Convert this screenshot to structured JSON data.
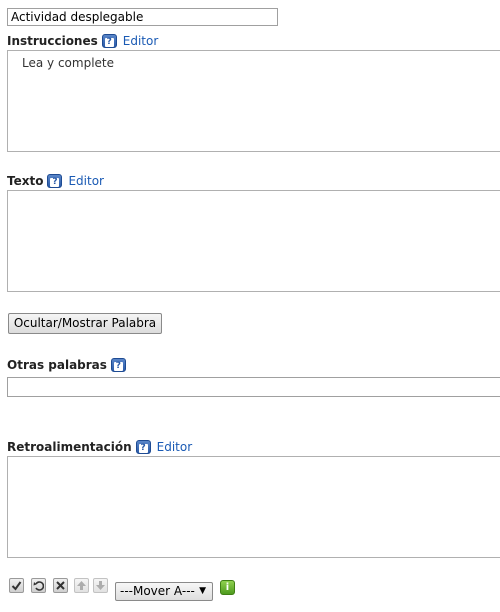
{
  "title_field": {
    "value": "Actividad desplegable"
  },
  "instructions": {
    "label": "Instrucciones",
    "help_glyph": "?",
    "editor_link": "Editor",
    "content": "Lea y complete"
  },
  "text_section": {
    "label": "Texto",
    "help_glyph": "?",
    "editor_link": "Editor",
    "content": ""
  },
  "toggle_button": {
    "label": "Ocultar/Mostrar Palabra"
  },
  "other_words": {
    "label": "Otras palabras",
    "help_glyph": "?",
    "value": ""
  },
  "feedback": {
    "label": "Retroalimentación",
    "help_glyph": "?",
    "editor_link": "Editor",
    "content": ""
  },
  "toolbar": {
    "icons": [
      "checkmark-icon",
      "undo-icon",
      "delete-icon",
      "arrow-up-icon",
      "arrow-down-icon"
    ],
    "move_select_value": "---Mover A---",
    "select_arrow": "▼",
    "info_glyph": "i"
  }
}
